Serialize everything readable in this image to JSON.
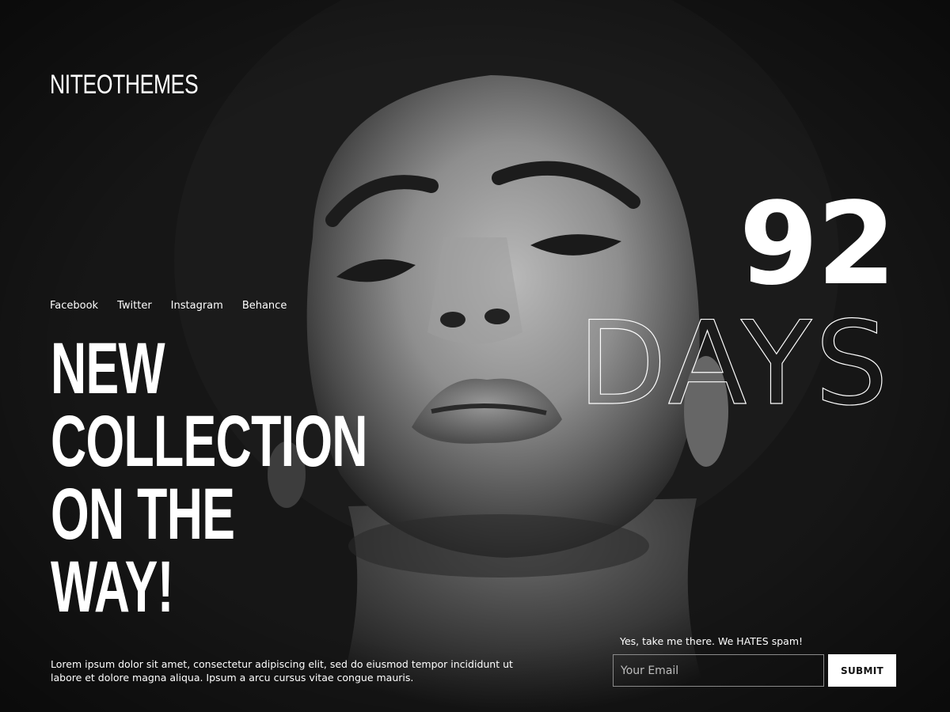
{
  "brand": {
    "logo": "NITEOTHEMES"
  },
  "social": {
    "links": [
      "Facebook",
      "Twitter",
      "Instagram",
      "Behance"
    ]
  },
  "hero": {
    "headline_lines": [
      "NEW",
      "COLLECTION",
      "ON THE",
      "WAY!"
    ]
  },
  "countdown": {
    "value": "92",
    "unit": "DAYS"
  },
  "footer": {
    "description": "Lorem ipsum dolor sit amet, consectetur adipiscing elit, sed do eiusmod tempor incididunt ut labore et dolore magna aliqua. Ipsum a arcu cursus vitae congue mauris."
  },
  "subscribe": {
    "label": "Yes, take me there. We HATES spam!",
    "email_placeholder": "Your Email",
    "submit_label": "SUBMIT"
  },
  "colors": {
    "background": "#161616",
    "text": "#ffffff",
    "button_bg": "#ffffff",
    "button_text": "#111111"
  }
}
